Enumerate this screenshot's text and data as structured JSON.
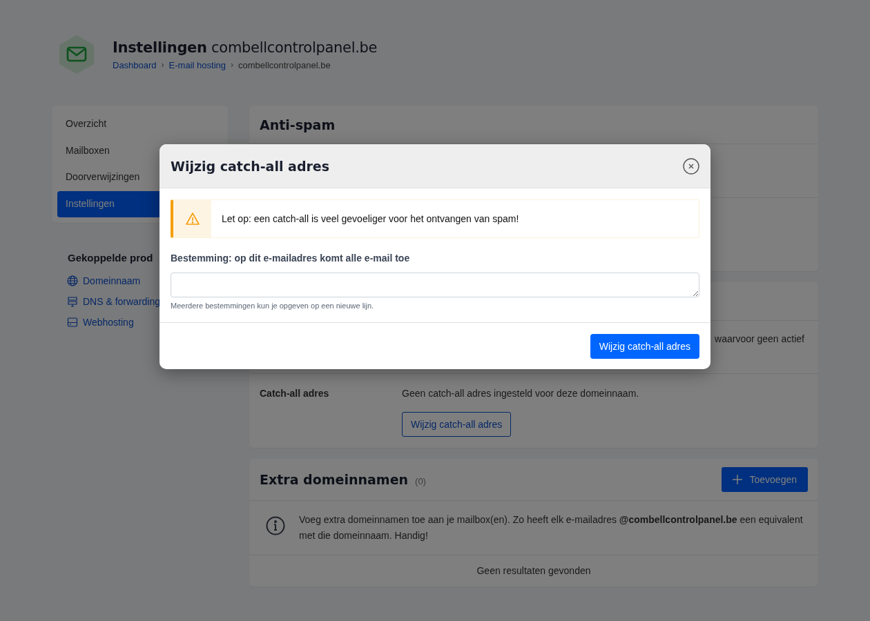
{
  "page": {
    "title": "Instellingen",
    "domain": "combellcontrolpanel.be",
    "breadcrumbs": [
      {
        "label": "Dashboard",
        "link": true
      },
      {
        "label": "E-mail hosting",
        "link": true,
        "separator": "›"
      },
      {
        "label": "combellcontrolpanel.be",
        "link": false,
        "separator": "›"
      }
    ]
  },
  "sidebar": {
    "items": [
      {
        "label": "Overzicht",
        "selected": false
      },
      {
        "label": "Mailboxen",
        "selected": false
      },
      {
        "label": "Doorverwijzingen",
        "selected": false
      },
      {
        "label": "Instellingen",
        "selected": true
      }
    ],
    "linked_title": "Gekoppelde prod",
    "linked": [
      {
        "label": "Domeinnaam",
        "kind": "globe"
      },
      {
        "label": "DNS & forwarding",
        "kind": "signpost"
      },
      {
        "label": "Webhosting",
        "kind": "server"
      }
    ]
  },
  "antispam": {
    "title": "Anti-spam"
  },
  "catchall_card": {
    "row_text": "waarvoor geen actief",
    "label": "Catch-all adres",
    "value": "Geen catch-all adres ingesteld voor deze domeinnaam.",
    "button": "Wijzig catch-all adres"
  },
  "extra": {
    "title": "Extra domeinnamen",
    "count": "(0)",
    "add_button": "Toevoegen",
    "info": "Voeg extra domeinnamen toe aan je mailbox(en). Zo heeft elk e-mailadres **@combellcontrolpanel.be** een equivalent met die domeinnaam. Handig!",
    "empty": "Geen resultaten gevonden"
  },
  "modal": {
    "title": "Wijzig catch-all adres",
    "alert": "Let op: een catch-all is veel gevoeliger voor het ontvangen van spam!",
    "field_label": "Bestemming: op dit e-mailadres komt alle e-mail toe",
    "help": "Meerdere bestemmingen kun je opgeven op een nieuwe lijn.",
    "submit": "Wijzig catch-all adres"
  }
}
